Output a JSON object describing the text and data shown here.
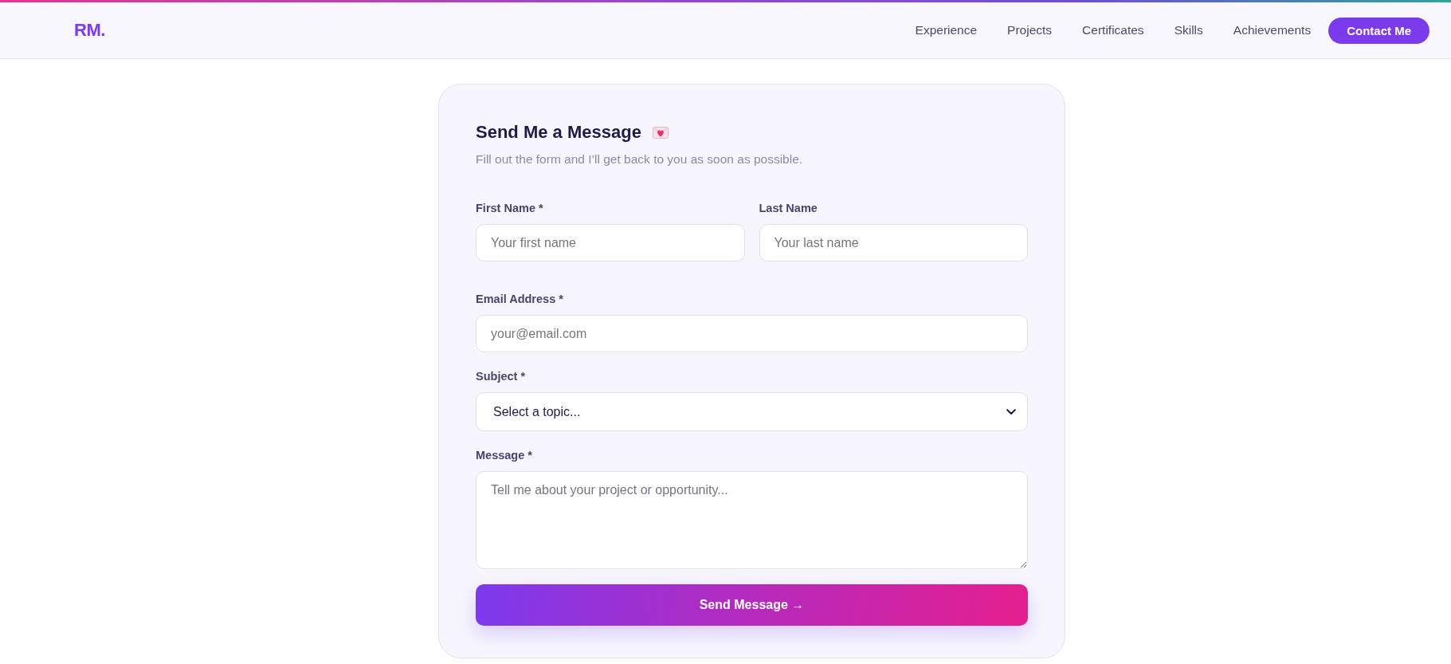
{
  "header": {
    "logo": "RM.",
    "nav": [
      {
        "label": "Experience",
        "kind": "link"
      },
      {
        "label": "Projects",
        "kind": "link"
      },
      {
        "label": "Certificates",
        "kind": "link"
      },
      {
        "label": "Skills",
        "kind": "link"
      },
      {
        "label": "Achievements",
        "kind": "link"
      },
      {
        "label": "Contact Me",
        "kind": "button"
      }
    ]
  },
  "form": {
    "title": "Send Me a Message",
    "subtitle": "Fill out the form and I’ll get back to you as soon as possible.",
    "rows": [
      {
        "fields": [
          {
            "kind": "text",
            "label": "First Name *",
            "placeholder": "Your first name"
          },
          {
            "kind": "text",
            "label": "Last Name",
            "placeholder": "Your last name"
          }
        ]
      },
      {
        "fields": [
          {
            "kind": "email",
            "label": "Email Address *",
            "placeholder": "your@email.com"
          }
        ]
      },
      {
        "fields": [
          {
            "kind": "select",
            "label": "Subject *",
            "value": "Select a topic..."
          }
        ]
      },
      {
        "fields": [
          {
            "kind": "textarea",
            "label": "Message *",
            "placeholder": "Tell me about your project or opportunity..."
          }
        ]
      }
    ],
    "submit": {
      "label": "Send Message →"
    }
  }
}
